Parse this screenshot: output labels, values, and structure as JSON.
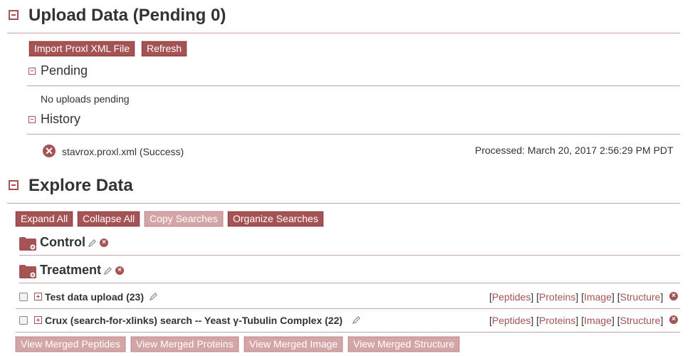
{
  "upload": {
    "title": "Upload Data (Pending 0)",
    "import_button": "Import Proxl XML File",
    "refresh_button": "Refresh",
    "pending": {
      "heading": "Pending",
      "empty_text": "No uploads pending"
    },
    "history": {
      "heading": "History",
      "items": [
        {
          "file": "stavrox.proxl.xml (Success)",
          "processed": "Processed: March 20, 2017 2:56:29 PM PDT"
        }
      ]
    }
  },
  "explore": {
    "title": "Explore Data",
    "buttons": {
      "expand_all": "Expand All",
      "collapse_all": "Collapse All",
      "copy_searches": "Copy Searches",
      "organize_searches": "Organize Searches"
    },
    "folders": [
      {
        "name": "Control"
      },
      {
        "name": "Treatment"
      }
    ],
    "searches": [
      {
        "name": "Test data upload (23)"
      },
      {
        "name": "Crux (search-for-xlinks) search -- Yeast γ-Tubulin Complex (22)"
      }
    ],
    "link_labels": {
      "peptides": "Peptides",
      "proteins": "Proteins",
      "image": "Image",
      "structure": "Structure"
    },
    "merged_buttons": {
      "peptides": "View Merged Peptides",
      "proteins": "View Merged Proteins",
      "image": "View Merged Image",
      "structure": "View Merged Structure"
    }
  },
  "colors": {
    "accent": "#A55354",
    "accent_light": "#D4A5A6",
    "rule": "#C9A3A3"
  }
}
